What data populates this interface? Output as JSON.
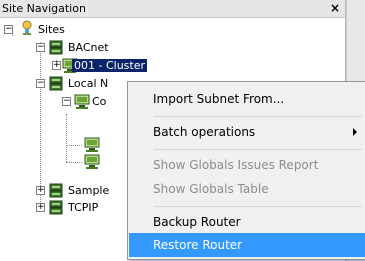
{
  "panel": {
    "title": "Site Navigation",
    "close_glyph": "×"
  },
  "tree": {
    "root": {
      "label": "Sites",
      "icon": "globe-person-icon",
      "expanded": true
    },
    "nodes": [
      {
        "label": "BACnet",
        "icon": "network-icon",
        "expanded": true
      },
      {
        "label": "001 - Cluster",
        "icon": "computer-icon",
        "expanded": false,
        "selected": true
      },
      {
        "label": "Local N",
        "icon": "network-icon",
        "expanded": true
      },
      {
        "label": "Co",
        "icon": "computer-icon",
        "expanded": true
      },
      {
        "label": "",
        "icon": "computer-icon"
      },
      {
        "label": "",
        "icon": "computer-icon"
      },
      {
        "label": "Sample",
        "icon": "network-icon",
        "expanded": false
      },
      {
        "label": "TCPIP",
        "icon": "network-icon",
        "expanded": false
      }
    ]
  },
  "context_menu": {
    "items": [
      {
        "label": "Import Subnet From...",
        "enabled": true,
        "submenu": false
      },
      {
        "label": "Batch operations",
        "enabled": true,
        "submenu": true
      },
      {
        "label": "Show Globals Issues Report",
        "enabled": false,
        "submenu": false
      },
      {
        "label": "Show Globals Table",
        "enabled": false,
        "submenu": false
      },
      {
        "label": "Backup Router",
        "enabled": true,
        "submenu": false
      },
      {
        "label": "Restore Router",
        "enabled": true,
        "submenu": false,
        "highlighted": true
      }
    ]
  },
  "colors": {
    "menu_highlight": "#3399ff",
    "selection": "#0a246a",
    "disabled_text": "#8d8d8d"
  }
}
